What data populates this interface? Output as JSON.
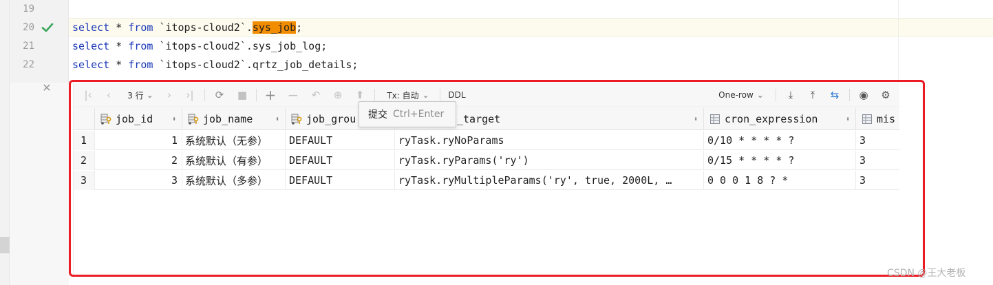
{
  "editor": {
    "lines": [
      {
        "number": "19"
      },
      {
        "number": "20",
        "status": "check-icon",
        "parts": [
          "select",
          " * ",
          "from",
          " `itops-cloud2`.",
          "sys_job",
          ";"
        ]
      },
      {
        "number": "21",
        "parts": [
          "select",
          " * ",
          "from",
          " `itops-cloud2`.sys_job_log;"
        ]
      },
      {
        "number": "22",
        "parts": [
          "select",
          " * ",
          "from",
          " `itops-cloud2`.qrtz_job_details;"
        ]
      }
    ],
    "highlight_color": "#f28c00",
    "keyword_color": "#1a37b8"
  },
  "toolbar": {
    "rows_label": "3 行",
    "tx_label": "Tx: 自动",
    "ddl_label": "DDL",
    "view_mode": "One-row",
    "icons": [
      "first-page-icon",
      "prev-page-icon",
      "next-page-icon",
      "last-page-icon",
      "refresh-icon",
      "stop-icon",
      "add-row-icon",
      "delete-row-icon",
      "revert-icon",
      "submit-icon",
      "up-icon",
      "download-icon",
      "upload-icon",
      "compare-icon",
      "view-icon",
      "settings-icon"
    ]
  },
  "grid": {
    "columns": [
      {
        "name": "job_id",
        "icon": "primary-key-column-icon"
      },
      {
        "name": "job_name",
        "icon": "primary-key-column-icon"
      },
      {
        "name": "job_grou",
        "icon": "primary-key-column-icon"
      },
      {
        "name": "_target",
        "icon": ""
      },
      {
        "name": "cron_expression",
        "icon": "column-icon"
      },
      {
        "name": "mis",
        "icon": "column-icon"
      }
    ],
    "rows": [
      {
        "n": "1",
        "cells": [
          "1",
          "系统默认（无参）",
          "DEFAULT",
          "ryTask.ryNoParams",
          "0/10 * * * * ?",
          "3"
        ]
      },
      {
        "n": "2",
        "cells": [
          "2",
          "系统默认（有参）",
          "DEFAULT",
          "ryTask.ryParams('ry')",
          "0/15 * * * * ?",
          "3"
        ]
      },
      {
        "n": "3",
        "cells": [
          "3",
          "系统默认（多参）",
          "DEFAULT",
          "ryTask.ryMultipleParams('ry', true, 2000L, …",
          "0 0 0 1 8 ? *",
          "3"
        ]
      }
    ]
  },
  "tooltip": {
    "action": "提交",
    "shortcut": "Ctrl+Enter"
  },
  "annotation": {
    "color": "#ec1c24"
  },
  "watermark": "CSDN @王大老板"
}
